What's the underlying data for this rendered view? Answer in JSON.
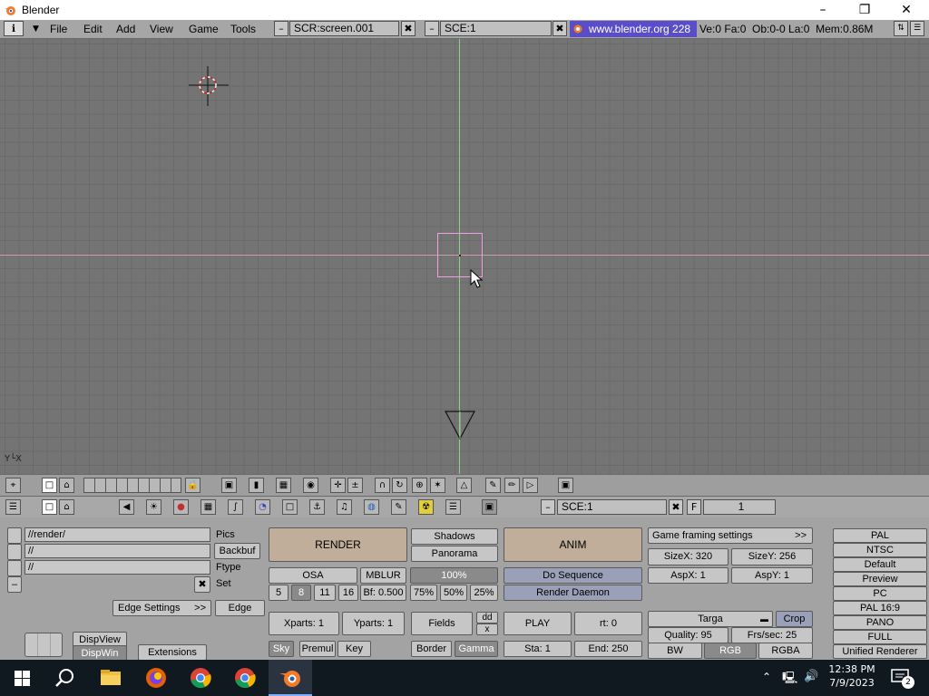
{
  "window": {
    "title": "Blender",
    "minimize": "–",
    "maximize": "❐",
    "close": "✕"
  },
  "menubar": {
    "menus": [
      "File",
      "Edit",
      "Add",
      "View",
      "Game",
      "Tools"
    ],
    "screen_field": "SCR:screen.001",
    "scene_field": "SCE:1",
    "site": "www.blender.org 228",
    "stats": "Ve:0 Fa:0  Ob:0-0 La:0  Mem:0.86M",
    "minus": "–",
    "close_x": "✖"
  },
  "viewport": {
    "axis_label": "Y└X"
  },
  "buttons_header": {
    "scene": "SCE:1",
    "frame_label": "F",
    "frame": "1"
  },
  "render_panel": {
    "paths": [
      "//render/",
      "//",
      "//"
    ],
    "path_labels": [
      "Pics",
      "Backbuf",
      "Ftype"
    ],
    "set_label": "Set",
    "edge_settings": "Edge Settings",
    "edge_settings_arrow": ">>",
    "edge": "Edge",
    "dispview": "DispView",
    "dispwin": "DispWin",
    "extensions": "Extensions",
    "render": "RENDER",
    "shadows": "Shadows",
    "panorama": "Panorama",
    "osa": "OSA",
    "mblur": "MBLUR",
    "percent": "100%",
    "osa_levels": [
      "5",
      "8",
      "11",
      "16"
    ],
    "bf": "Bf: 0.500",
    "scales": [
      "75%",
      "50%",
      "25%"
    ],
    "xparts": "Xparts: 1",
    "yparts": "Yparts: 1",
    "fields": "Fields",
    "dd": "dd",
    "x": "x",
    "sky": "Sky",
    "premul": "Premul",
    "key": "Key",
    "border": "Border",
    "gamma": "Gamma",
    "anim": "ANIM",
    "do_sequence": "Do Sequence",
    "render_daemon": "Render Daemon",
    "play": "PLAY",
    "rt": "rt: 0",
    "sta": "Sta: 1",
    "end": "End: 250"
  },
  "format_panel": {
    "game_framing": "Game framing settings",
    "game_framing_arrow": ">>",
    "sizex": "SizeX: 320",
    "sizey": "SizeY: 256",
    "aspx": "AspX: 1",
    "aspy": "AspY: 1",
    "format": "Targa",
    "crop": "Crop",
    "quality": "Quality: 95",
    "fps": "Frs/sec: 25",
    "bw": "BW",
    "rgb": "RGB",
    "rgba": "RGBA",
    "presets": [
      "PAL",
      "NTSC",
      "Default",
      "Preview",
      "PC",
      "PAL 16:9",
      "PANO",
      "FULL",
      "Unified Renderer"
    ]
  },
  "taskbar": {
    "time": "12:38 PM",
    "date": "7/9/2023",
    "notifications": "2"
  }
}
